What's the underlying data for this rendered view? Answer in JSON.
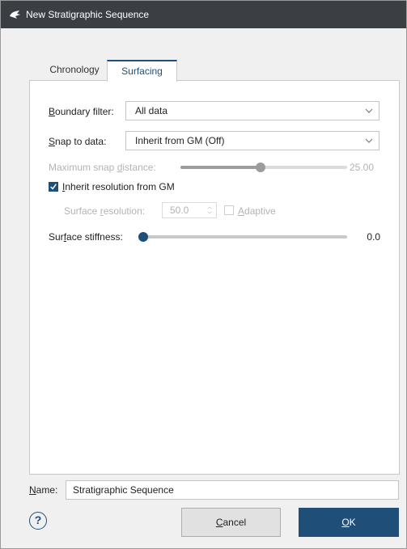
{
  "window": {
    "title": "New Stratigraphic Sequence",
    "accent_color": "#1f4e79",
    "titlebar_color": "#3b3f44"
  },
  "tabs": [
    {
      "label": "Chronology",
      "active": false
    },
    {
      "label": "Surfacing",
      "active": true
    }
  ],
  "surfacing": {
    "boundary_filter": {
      "label_mnemonic": "B",
      "label_rest": "oundary filter:",
      "value": "All data"
    },
    "snap_to_data": {
      "label_mnemonic": "S",
      "label_rest": "nap to data:",
      "value": "Inherit from GM (Off)"
    },
    "max_snap_distance": {
      "label_pre": "Maximum snap ",
      "label_mnemonic": "d",
      "label_rest": "istance:",
      "value": "25.00",
      "fraction": 0.48,
      "enabled": false
    },
    "inherit_resolution": {
      "label_mnemonic": "I",
      "label_rest": "nherit resolution from GM",
      "checked": true
    },
    "surface_resolution": {
      "label_pre": "Surface ",
      "label_mnemonic": "r",
      "label_rest": "esolution:",
      "value": "50.0",
      "enabled": false
    },
    "adaptive": {
      "label_mnemonic": "A",
      "label_rest": "daptive",
      "checked": false,
      "enabled": false
    },
    "surface_stiffness": {
      "label_pre": "Sur",
      "label_mnemonic": "f",
      "label_rest": "ace stiffness:",
      "value": "0.0",
      "fraction": 0.0
    }
  },
  "name_field": {
    "label_mnemonic": "N",
    "label_rest": "ame:",
    "value": "Stratigraphic Sequence"
  },
  "buttons": {
    "help": "?",
    "cancel": {
      "mnemonic": "C",
      "rest": "ancel"
    },
    "ok": {
      "mnemonic": "O",
      "rest": "K"
    }
  }
}
